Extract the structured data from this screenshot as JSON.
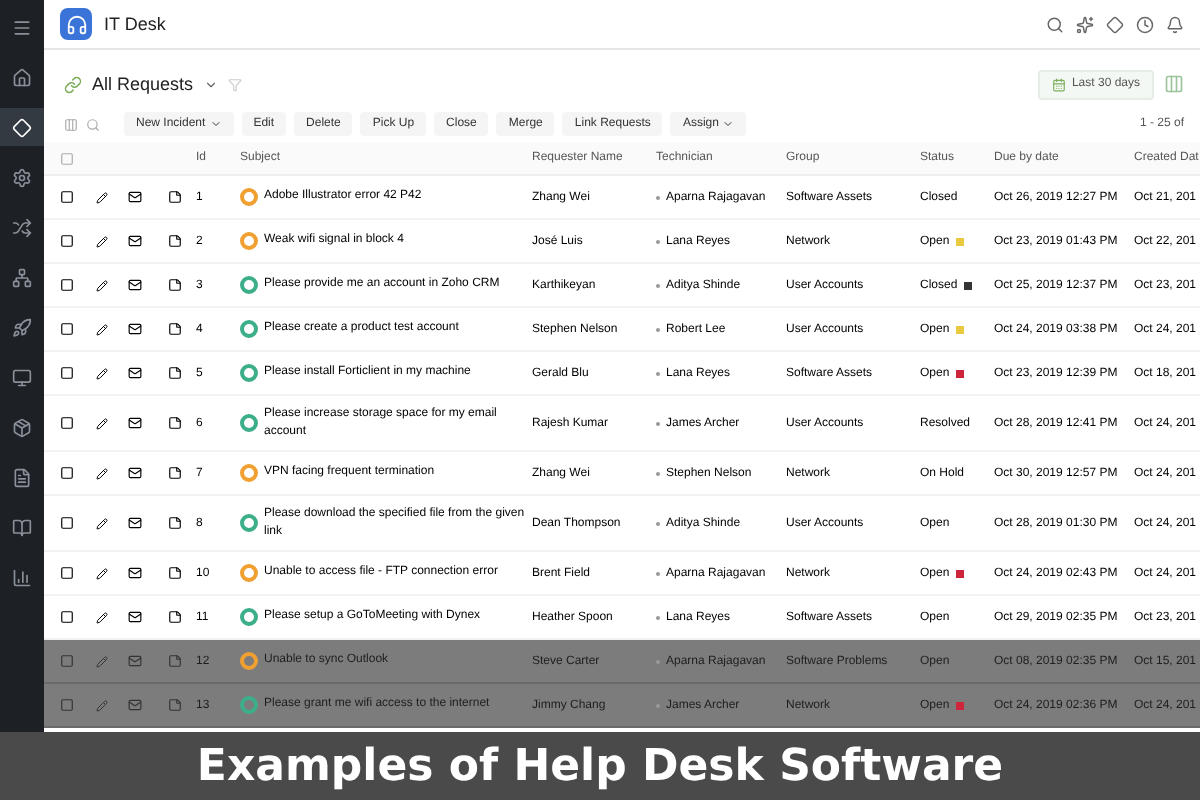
{
  "app": {
    "title": "IT Desk"
  },
  "sidebar": {
    "items": [
      {
        "selected": false
      },
      {
        "selected": false
      },
      {
        "selected": true
      },
      {
        "selected": false
      },
      {
        "selected": false
      },
      {
        "selected": false
      },
      {
        "selected": false
      },
      {
        "selected": false
      },
      {
        "selected": false
      },
      {
        "selected": false
      },
      {
        "selected": false
      },
      {
        "selected": false
      }
    ]
  },
  "view": {
    "title": "All Requests",
    "filter_button": "Last 30 days",
    "pagination": "1 - 25 of"
  },
  "toolbar": [
    {
      "label": "New Incident",
      "dropdown": true
    },
    {
      "label": "Edit",
      "dropdown": false
    },
    {
      "label": "Delete",
      "dropdown": false
    },
    {
      "label": "Pick Up",
      "dropdown": false
    },
    {
      "label": "Close",
      "dropdown": false
    },
    {
      "label": "Merge",
      "dropdown": false
    },
    {
      "label": "Link Requests",
      "dropdown": false
    },
    {
      "label": "Assign",
      "dropdown": true
    }
  ],
  "table": {
    "all_checked": false,
    "columns": [
      "Id",
      "Subject",
      "Requester Name",
      "Technician",
      "Group",
      "Status",
      "Due by date",
      "Created Dat"
    ],
    "rows": [
      {
        "checked": false,
        "dimmed": false,
        "id": "1",
        "kind": "incident",
        "subject": "Adobe Illustrator error 42 P42",
        "requester": "Zhang Wei",
        "technician": "Aparna Rajagavan",
        "group": "Software Assets",
        "status": "Closed",
        "due": "Oct 26, 2019 12:27 PM",
        "created": "Oct 21, 201"
      },
      {
        "checked": false,
        "dimmed": false,
        "id": "2",
        "kind": "incident",
        "subject": "Weak wifi signal in block 4",
        "requester": "José Luis",
        "technician": "Lana Reyes",
        "group": "Network",
        "status": "Open",
        "color": "#e8c940",
        "due": "Oct 23, 2019 01:43 PM",
        "created": "Oct 22, 201"
      },
      {
        "checked": false,
        "dimmed": false,
        "id": "3",
        "kind": "request",
        "subject": "Please provide me an account in Zoho CRM",
        "requester": "Karthikeyan",
        "technician": "Aditya Shinde",
        "group": "User Accounts",
        "status": "Closed",
        "color": "#333333",
        "due": "Oct 25, 2019 12:37 PM",
        "created": "Oct 23, 201"
      },
      {
        "checked": false,
        "dimmed": false,
        "id": "4",
        "kind": "request",
        "subject": "Please create a product test account",
        "requester": "Stephen Nelson",
        "technician": "Robert Lee",
        "group": "User Accounts",
        "status": "Open",
        "color": "#e8c940",
        "due": "Oct 24, 2019 03:38 PM",
        "created": "Oct 24, 201"
      },
      {
        "checked": false,
        "dimmed": false,
        "id": "5",
        "kind": "request",
        "subject": "Please install Forticlient in my machine",
        "requester": "Gerald Blu",
        "technician": "Lana Reyes",
        "group": "Software Assets",
        "status": "Open",
        "color": "#d0243a",
        "due": "Oct 23, 2019 12:39 PM",
        "created": "Oct 18, 201"
      },
      {
        "checked": false,
        "dimmed": false,
        "id": "6",
        "kind": "request",
        "subject": "Please increase storage space for my email account",
        "requester": "Rajesh Kumar",
        "technician": "James Archer",
        "group": "User Accounts",
        "status": "Resolved",
        "due": "Oct 28, 2019 12:41 PM",
        "created": "Oct 24, 201"
      },
      {
        "checked": false,
        "dimmed": false,
        "id": "7",
        "kind": "incident",
        "subject": "VPN facing frequent termination",
        "requester": "Zhang Wei",
        "technician": "Stephen Nelson",
        "group": "Network",
        "status": "On Hold",
        "due": "Oct 30, 2019 12:57 PM",
        "created": "Oct 24, 201"
      },
      {
        "checked": false,
        "dimmed": false,
        "id": "8",
        "kind": "request",
        "subject": "Please download the specified file from the given link",
        "requester": "Dean Thompson",
        "technician": "Aditya Shinde",
        "group": "User Accounts",
        "status": "Open",
        "due": "Oct 28, 2019 01:30 PM",
        "created": "Oct 24, 201"
      },
      {
        "checked": false,
        "dimmed": false,
        "id": "10",
        "kind": "incident",
        "subject": "Unable to access file - FTP connection error",
        "requester": "Brent Field",
        "technician": "Aparna Rajagavan",
        "group": "Network",
        "status": "Open",
        "color": "#d0243a",
        "due": "Oct 24, 2019 02:43 PM",
        "created": "Oct 24, 201"
      },
      {
        "checked": false,
        "dimmed": false,
        "id": "11",
        "kind": "request",
        "subject": "Please setup a GoToMeeting with Dynex",
        "requester": "Heather Spoon",
        "technician": "Lana Reyes",
        "group": "Software Assets",
        "status": "Open",
        "due": "Oct 29, 2019 02:35 PM",
        "created": "Oct 23, 201"
      },
      {
        "checked": false,
        "dimmed": true,
        "id": "12",
        "kind": "incident",
        "subject": "Unable to sync Outlook",
        "requester": "Steve Carter",
        "technician": "Aparna Rajagavan",
        "group": "Software Problems",
        "status": "Open",
        "due": "Oct 08, 2019 02:35 PM",
        "created": "Oct 15, 201"
      },
      {
        "checked": false,
        "dimmed": true,
        "id": "13",
        "kind": "request",
        "subject": "Please grant me wifi access to the internet",
        "requester": "Jimmy Chang",
        "technician": "James Archer",
        "group": "Network",
        "status": "Open",
        "color": "#d0243a",
        "due": "Oct 24, 2019 02:36 PM",
        "created": "Oct 24, 201"
      }
    ]
  },
  "caption": "Examples of Help Desk Software"
}
